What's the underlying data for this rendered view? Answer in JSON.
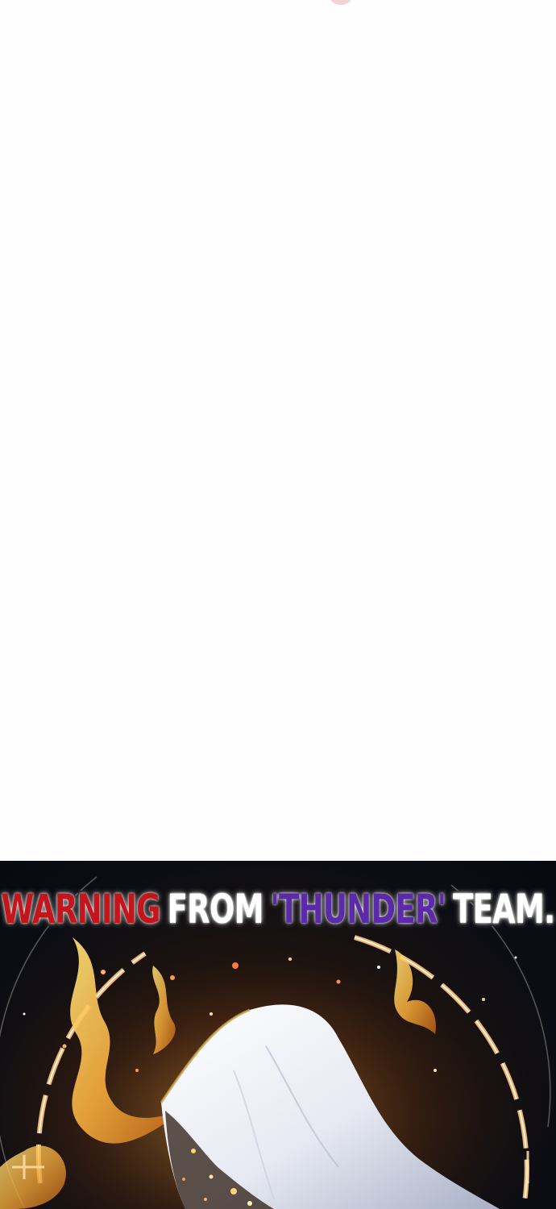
{
  "banner": {
    "word_warning": "WARNING",
    "word_from": "FROM",
    "word_thunder": "'THUNDER'",
    "word_team": "TEAM."
  },
  "colors": {
    "page_background": "#fefefe",
    "warning_red": "#c4151d",
    "thunder_purple": "#5a2aa8",
    "banner_white": "#ffffff",
    "art_background": "#0c0d14",
    "fire_gold": "#f2a93b",
    "cloak_white": "#eef0f5"
  },
  "artwork": {
    "subject": "white-cloaked figure in golden flames within a glowing magic circle"
  }
}
